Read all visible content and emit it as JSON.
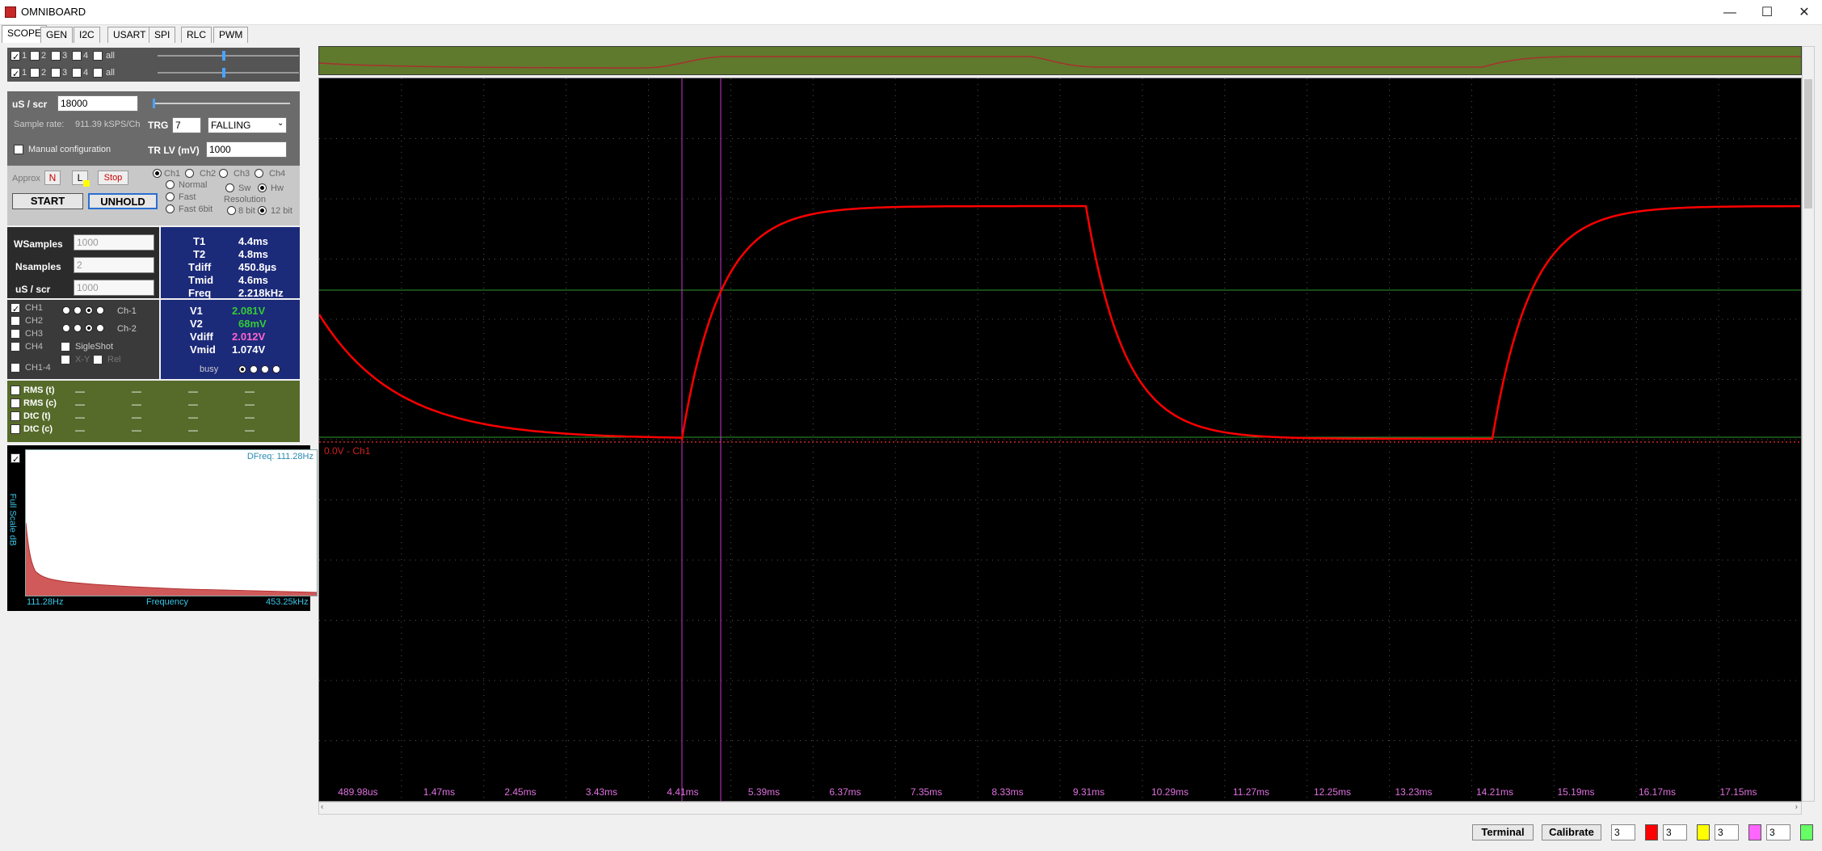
{
  "window": {
    "title": "OMNIBOARD",
    "min": "—",
    "max": "☐",
    "close": "✕"
  },
  "tabs": [
    "SCOPE",
    "GEN",
    "I2C",
    "USART",
    "SPI",
    "RLC",
    "PWM"
  ],
  "channel_rows": [
    {
      "items": [
        "1",
        "2",
        "3",
        "4",
        "all"
      ]
    },
    {
      "items": [
        "1",
        "2",
        "3",
        "4",
        "all"
      ]
    }
  ],
  "timebase": {
    "label": "uS / scr",
    "value": "18000"
  },
  "sample": {
    "label": "Sample rate:",
    "value": "911.39 kSPS/Ch"
  },
  "trigger": {
    "label": "TRG",
    "value": "7",
    "mode": "FALLING",
    "level_label": "TR LV (mV)",
    "level_value": "1000"
  },
  "manual": {
    "label": "Manual configuration"
  },
  "approx": {
    "label": "Approx",
    "n": "N",
    "l": "L",
    "stop": "Stop"
  },
  "trig_channels": [
    "Ch1",
    "Ch2",
    "Ch3",
    "Ch4"
  ],
  "modes": [
    "Normal",
    "Fast",
    "Fast 6bit"
  ],
  "resolution": {
    "label": "Resolution",
    "sw": "Sw",
    "hw": "Hw",
    "b8": "8 bit",
    "b12": "12 bit"
  },
  "controls": {
    "start": "START",
    "unhold": "UNHOLD"
  },
  "samples": {
    "wsamples_label": "WSamples",
    "wsamples_value": "1000",
    "nsamples_label": "Nsamples",
    "nsamples_value": "2",
    "us_label": "uS / scr",
    "us_value": "1000"
  },
  "time_meas": [
    {
      "label": "T1",
      "value": "4.4ms"
    },
    {
      "label": "T2",
      "value": "4.8ms"
    },
    {
      "label": "Tdiff",
      "value": "450.8µs"
    },
    {
      "label": "Tmid",
      "value": "4.6ms"
    },
    {
      "label": "Freq",
      "value": "2.218kHz"
    }
  ],
  "volt_meas": [
    {
      "label": "V1",
      "value": "2.081V",
      "color": "#33cc33"
    },
    {
      "label": "V2",
      "value": "68mV",
      "color": "#33cc33"
    },
    {
      "label": "Vdiff",
      "value": "2.012V",
      "color": "#ff66cc"
    },
    {
      "label": "Vmid",
      "value": "1.074V",
      "color": "#ffffff"
    }
  ],
  "ch_select": [
    "CH1",
    "CH2",
    "CH3",
    "CH4",
    "CH1-4"
  ],
  "cursor_rows": [
    "Ch-1",
    "Ch-2"
  ],
  "singleshot": "SigleShot",
  "xy": "X-Y",
  "rel": "Rel",
  "busy": "busy",
  "stats": [
    {
      "label": "RMS (t)",
      "vals": [
        "—",
        "—",
        "—",
        "—"
      ]
    },
    {
      "label": "RMS (c)",
      "vals": [
        "—",
        "—",
        "—",
        "—"
      ]
    },
    {
      "label": "DtC (t)",
      "vals": [
        "—",
        "—",
        "—",
        "—"
      ]
    },
    {
      "label": "DtC (c)",
      "vals": [
        "—",
        "—",
        "—",
        "—"
      ]
    }
  ],
  "fft": {
    "dfreq": "DFreq: 111.28Hz",
    "ylabel": "Full Scale dB",
    "xmin": "111.28Hz",
    "xlabel": "Frequency",
    "xmax": "453.25kHz"
  },
  "scope_labels": {
    "ch_marker": "0.0V - Ch1"
  },
  "x_ticks": [
    "489.98us",
    "1.47ms",
    "2.45ms",
    "3.43ms",
    "4.41ms",
    "5.39ms",
    "6.37ms",
    "7.35ms",
    "8.33ms",
    "9.31ms",
    "10.29ms",
    "11.27ms",
    "12.25ms",
    "13.23ms",
    "14.21ms",
    "15.19ms",
    "16.17ms",
    "17.15ms"
  ],
  "bottom": {
    "terminal": "Terminal",
    "calibrate": "Calibrate",
    "spins": [
      "3",
      "3",
      "3",
      "3"
    ]
  },
  "colors": {
    "ch1": "#ff0000",
    "ch2": "#ffff00",
    "ch3": "#ff66ff",
    "ch4": "#66ff66",
    "cursor": "#cc33cc",
    "level": "#2e9a2e"
  }
}
